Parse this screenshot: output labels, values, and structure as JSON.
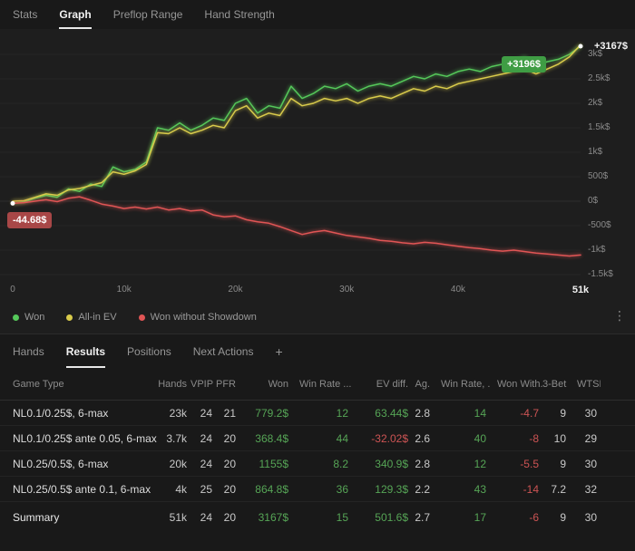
{
  "colors": {
    "won_line": "#55c85a",
    "allin_ev_line": "#d9cb4b",
    "won_without_sd_line": "#e05555",
    "badge_positive_bg": "#3f9d44",
    "badge_negative_bg": "#a84747",
    "table_positive": "#56a556",
    "table_negative": "#cd5454"
  },
  "top_tabs": [
    {
      "label": "Stats",
      "active": false
    },
    {
      "label": "Graph",
      "active": true
    },
    {
      "label": "Preflop Range",
      "active": false
    },
    {
      "label": "Hand Strength",
      "active": false
    }
  ],
  "chart_data": {
    "type": "line",
    "x_unit": "hands",
    "x_step_hands": 1000,
    "x_max_hands": 51000,
    "ylim": [
      -1500,
      3300
    ],
    "x_ticks": [
      {
        "label": "0",
        "hands": 0
      },
      {
        "label": "10k",
        "hands": 10000
      },
      {
        "label": "20k",
        "hands": 20000
      },
      {
        "label": "30k",
        "hands": 30000
      },
      {
        "label": "40k",
        "hands": 40000
      },
      {
        "label": "51k",
        "hands": 51000,
        "emphasis": true
      }
    ],
    "y_ticks": [
      {
        "label": "3k$",
        "value": 3000
      },
      {
        "label": "2.5k$",
        "value": 2500
      },
      {
        "label": "2k$",
        "value": 2000
      },
      {
        "label": "1.5k$",
        "value": 1500
      },
      {
        "label": "1k$",
        "value": 1000
      },
      {
        "label": "500$",
        "value": 500
      },
      {
        "label": "0$",
        "value": 0
      },
      {
        "label": "-500$",
        "value": -500
      },
      {
        "label": "-1k$",
        "value": -1000
      },
      {
        "label": "-1.5k$",
        "value": -1500
      }
    ],
    "series": [
      {
        "name": "Won",
        "color": "#55c85a",
        "final_value": 3167,
        "values": [
          -45,
          -20,
          60,
          120,
          80,
          250,
          200,
          350,
          300,
          700,
          600,
          650,
          800,
          1500,
          1450,
          1600,
          1450,
          1550,
          1700,
          1650,
          2000,
          2100,
          1800,
          1950,
          1900,
          2350,
          2100,
          2200,
          2350,
          2300,
          2400,
          2250,
          2350,
          2400,
          2350,
          2450,
          2550,
          2500,
          2600,
          2550,
          2650,
          2700,
          2650,
          2750,
          2800,
          2850,
          2950,
          2750,
          2850,
          2900,
          3000,
          3167
        ]
      },
      {
        "name": "All-in EV",
        "color": "#d9cb4b",
        "final_value": 3196,
        "values": [
          0,
          10,
          80,
          150,
          120,
          230,
          260,
          320,
          380,
          600,
          550,
          620,
          750,
          1400,
          1380,
          1500,
          1380,
          1450,
          1550,
          1500,
          1850,
          1950,
          1700,
          1800,
          1750,
          2100,
          1950,
          2000,
          2100,
          2050,
          2100,
          2000,
          2100,
          2150,
          2100,
          2200,
          2300,
          2250,
          2350,
          2300,
          2400,
          2450,
          2500,
          2550,
          2600,
          2650,
          2700,
          2600,
          2700,
          2800,
          2950,
          3196
        ]
      },
      {
        "name": "Won without Showdown",
        "color": "#e05555",
        "final_value": -1100,
        "values": [
          -45,
          -30,
          0,
          30,
          -10,
          60,
          90,
          20,
          -60,
          -100,
          -150,
          -120,
          -160,
          -120,
          -180,
          -150,
          -200,
          -180,
          -280,
          -320,
          -300,
          -380,
          -420,
          -450,
          -520,
          -600,
          -680,
          -630,
          -600,
          -650,
          -700,
          -730,
          -760,
          -800,
          -820,
          -850,
          -870,
          -840,
          -860,
          -890,
          -920,
          -950,
          -970,
          -1000,
          -1020,
          -1000,
          -1030,
          -1060,
          -1080,
          -1100,
          -1120,
          -1100
        ]
      }
    ],
    "annotations": {
      "start_badge": "-44.68$",
      "end_value_label": "+3167$",
      "ev_badge": "+3196$"
    },
    "legend_position": "bottom",
    "grid": true
  },
  "menu_icon": "⋮",
  "bottom_tabs": [
    {
      "label": "Hands",
      "active": false
    },
    {
      "label": "Results",
      "active": true
    },
    {
      "label": "Positions",
      "active": false
    },
    {
      "label": "Next Actions",
      "active": false
    },
    {
      "label": "+",
      "active": false
    }
  ],
  "table": {
    "columns": [
      {
        "key": "game_type",
        "label": "Game Type",
        "tone": "plain"
      },
      {
        "key": "hands",
        "label": "Hands",
        "tone": "plain"
      },
      {
        "key": "vpip",
        "label": "VPIP",
        "tone": "plain"
      },
      {
        "key": "pfr",
        "label": "PFR",
        "tone": "plain"
      },
      {
        "key": "won",
        "label": "Won",
        "tone": "money"
      },
      {
        "key": "win_rate",
        "label": "Win Rate ...",
        "tone": "money"
      },
      {
        "key": "ev_diff",
        "label": "EV diff.",
        "tone": "money"
      },
      {
        "key": "ag",
        "label": "Ag.",
        "tone": "plain"
      },
      {
        "key": "win_rate_2",
        "label": "Win Rate, ...",
        "tone": "money"
      },
      {
        "key": "won_without",
        "label": "Won With...",
        "tone": "money"
      },
      {
        "key": "three_bet",
        "label": "3-Bet",
        "tone": "plain"
      },
      {
        "key": "wtsd",
        "label": "WTSD ...",
        "tone": "plain"
      }
    ],
    "rows": [
      {
        "game_type": "NL0.1/0.25$, 6-max",
        "hands": "23k",
        "vpip": "24",
        "pfr": "21",
        "won": "779.2$",
        "win_rate": "12",
        "ev_diff": "63.44$",
        "ag": "2.8",
        "win_rate_2": "14",
        "won_without": "-4.7",
        "three_bet": "9",
        "wtsd": "30"
      },
      {
        "game_type": "NL0.1/0.25$ ante 0.05, 6-max",
        "hands": "3.7k",
        "vpip": "24",
        "pfr": "20",
        "won": "368.4$",
        "win_rate": "44",
        "ev_diff": "-32.02$",
        "ag": "2.6",
        "win_rate_2": "40",
        "won_without": "-8",
        "three_bet": "10",
        "wtsd": "29"
      },
      {
        "game_type": "NL0.25/0.5$, 6-max",
        "hands": "20k",
        "vpip": "24",
        "pfr": "20",
        "won": "1155$",
        "win_rate": "8.2",
        "ev_diff": "340.9$",
        "ag": "2.8",
        "win_rate_2": "12",
        "won_without": "-5.5",
        "three_bet": "9",
        "wtsd": "30"
      },
      {
        "game_type": "NL0.25/0.5$ ante 0.1, 6-max",
        "hands": "4k",
        "vpip": "25",
        "pfr": "20",
        "won": "864.8$",
        "win_rate": "36",
        "ev_diff": "129.3$",
        "ag": "2.2",
        "win_rate_2": "43",
        "won_without": "-14",
        "three_bet": "7.2",
        "wtsd": "32"
      }
    ],
    "summary": {
      "game_type": "Summary",
      "hands": "51k",
      "vpip": "24",
      "pfr": "20",
      "won": "3167$",
      "win_rate": "15",
      "ev_diff": "501.6$",
      "ag": "2.7",
      "win_rate_2": "17",
      "won_without": "-6",
      "three_bet": "9",
      "wtsd": "30"
    }
  }
}
